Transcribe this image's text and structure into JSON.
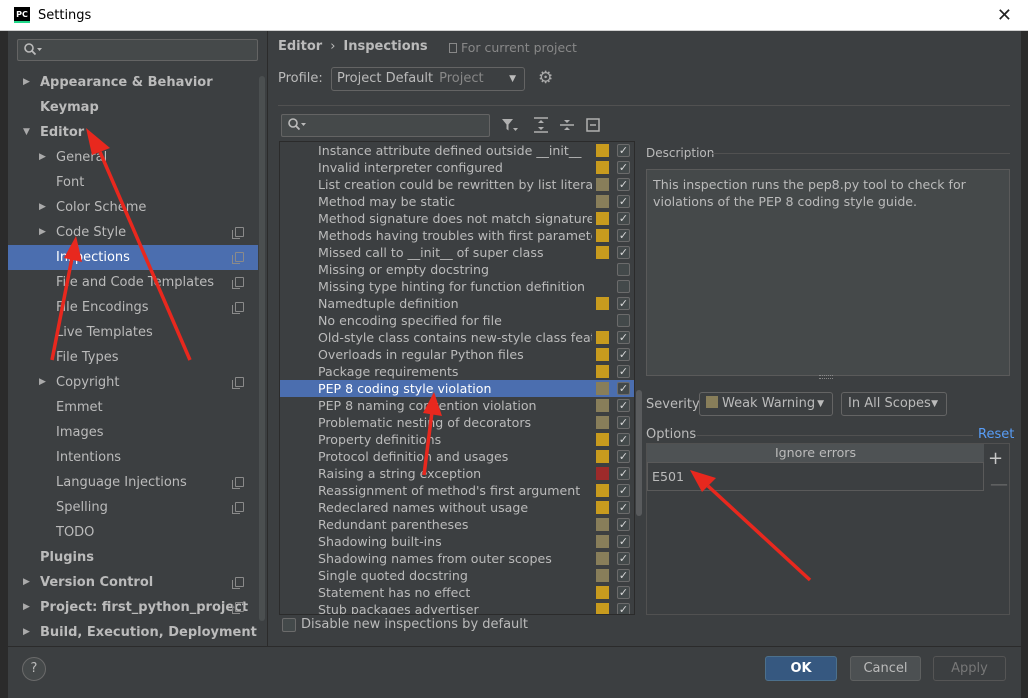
{
  "window": {
    "title": "Settings",
    "app_icon": "PC",
    "close_glyph": "✕"
  },
  "sidebar": {
    "search_placeholder": "",
    "items": [
      {
        "label": "Appearance & Behavior",
        "bold": true,
        "arrow": "right"
      },
      {
        "label": "Keymap",
        "bold": true
      },
      {
        "label": "Editor",
        "bold": true,
        "arrow": "down"
      },
      {
        "label": "General",
        "arrow": "right"
      },
      {
        "label": "Font"
      },
      {
        "label": "Color Scheme",
        "arrow": "right"
      },
      {
        "label": "Code Style",
        "arrow": "right",
        "copy": true
      },
      {
        "label": "Inspections",
        "selected": true,
        "copy": true
      },
      {
        "label": "File and Code Templates",
        "copy": true
      },
      {
        "label": "File Encodings",
        "copy": true
      },
      {
        "label": "Live Templates"
      },
      {
        "label": "File Types"
      },
      {
        "label": "Copyright",
        "arrow": "right",
        "copy": true
      },
      {
        "label": "Emmet"
      },
      {
        "label": "Images"
      },
      {
        "label": "Intentions"
      },
      {
        "label": "Language Injections",
        "copy": true
      },
      {
        "label": "Spelling",
        "copy": true
      },
      {
        "label": "TODO"
      },
      {
        "label": "Plugins",
        "bold": true
      },
      {
        "label": "Version Control",
        "bold": true,
        "arrow": "right",
        "copy": true
      },
      {
        "label": "Project: first_python_project",
        "bold": true,
        "arrow": "right",
        "copy": true
      },
      {
        "label": "Build, Execution, Deployment",
        "bold": true,
        "arrow": "right"
      }
    ]
  },
  "breadcrumb": {
    "parent": "Editor",
    "separator": "›",
    "current": "Inspections",
    "scope_note": "For current project"
  },
  "profile": {
    "label": "Profile:",
    "value": "Project Default",
    "sub": "Project"
  },
  "colors": {
    "weak_warning": "#887e5a",
    "warning": "#c89b1e",
    "error": "#9d2a2a",
    "selection": "#4b6eaf",
    "link": "#589df6"
  },
  "inspections": [
    {
      "name": "Instance attribute defined outside __init__",
      "severity": "warning",
      "checked": true
    },
    {
      "name": "Invalid interpreter configured",
      "severity": "warning",
      "checked": true
    },
    {
      "name": "List creation could be rewritten by list literal",
      "severity": "weak_warning",
      "checked": true
    },
    {
      "name": "Method may be static",
      "severity": "weak_warning",
      "checked": true
    },
    {
      "name": "Method signature does not match signature of",
      "severity": "warning",
      "checked": true
    },
    {
      "name": "Methods having troubles with first parameter",
      "severity": "warning",
      "checked": true
    },
    {
      "name": "Missed call to __init__ of super class",
      "severity": "warning",
      "checked": true
    },
    {
      "name": "Missing or empty docstring",
      "severity": "none",
      "checked": false
    },
    {
      "name": "Missing type hinting for function definition",
      "severity": "none",
      "checked": false
    },
    {
      "name": "Namedtuple definition",
      "severity": "warning",
      "checked": true
    },
    {
      "name": "No encoding specified for file",
      "severity": "none",
      "checked": false
    },
    {
      "name": "Old-style class contains new-style class features",
      "severity": "warning",
      "checked": true
    },
    {
      "name": "Overloads in regular Python files",
      "severity": "warning",
      "checked": true
    },
    {
      "name": "Package requirements",
      "severity": "warning",
      "checked": true
    },
    {
      "name": "PEP 8 coding style violation",
      "severity": "weak_warning",
      "checked": true,
      "selected": true
    },
    {
      "name": "PEP 8 naming convention violation",
      "severity": "weak_warning",
      "checked": true
    },
    {
      "name": "Problematic nesting of decorators",
      "severity": "weak_warning",
      "checked": true
    },
    {
      "name": "Property definitions",
      "severity": "warning",
      "checked": true
    },
    {
      "name": "Protocol definition and usages",
      "severity": "warning",
      "checked": true
    },
    {
      "name": "Raising a string exception",
      "severity": "error",
      "checked": true
    },
    {
      "name": "Reassignment of method's first argument",
      "severity": "warning",
      "checked": true
    },
    {
      "name": "Redeclared names without usage",
      "severity": "warning",
      "checked": true
    },
    {
      "name": "Redundant parentheses",
      "severity": "weak_warning",
      "checked": true
    },
    {
      "name": "Shadowing built-ins",
      "severity": "weak_warning",
      "checked": true
    },
    {
      "name": "Shadowing names from outer scopes",
      "severity": "weak_warning",
      "checked": true
    },
    {
      "name": "Single quoted docstring",
      "severity": "weak_warning",
      "checked": true
    },
    {
      "name": "Statement has no effect",
      "severity": "warning",
      "checked": true
    },
    {
      "name": "Stub packages advertiser",
      "severity": "warning",
      "checked": true
    }
  ],
  "disable_new": {
    "label": "Disable new inspections by default",
    "checked": false
  },
  "description": {
    "title": "Description",
    "text": "This inspection runs the pep8.py tool to check for violations of the PEP 8 coding style guide."
  },
  "severity": {
    "label": "Severity:",
    "value": "Weak Warning",
    "scope": "In All Scopes"
  },
  "options": {
    "title": "Options",
    "reset_label": "Reset",
    "column_header": "Ignore errors",
    "rows": [
      "E501"
    ],
    "add_glyph": "+",
    "remove_glyph": "—"
  },
  "buttons": {
    "help": "?",
    "ok": "OK",
    "cancel": "Cancel",
    "apply": "Apply"
  }
}
